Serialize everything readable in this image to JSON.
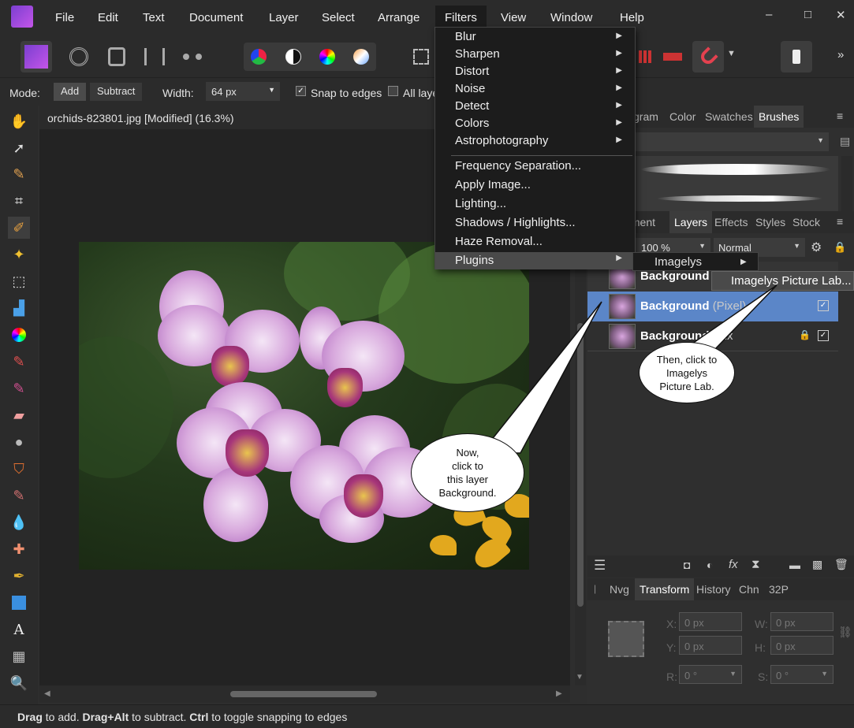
{
  "menubar": {
    "items": [
      "File",
      "Edit",
      "Text",
      "Document",
      "Layer",
      "Select",
      "Arrange",
      "Filters",
      "View",
      "Window",
      "Help"
    ],
    "active": "Filters",
    "window_controls": [
      "–",
      "□",
      "✕"
    ]
  },
  "context": {
    "mode_label": "Mode:",
    "add_label": "Add",
    "subtract_label": "Subtract",
    "width_label": "Width:",
    "width_value": "64 px",
    "snap_label": "Snap to edges",
    "all_layers_label": "All laye"
  },
  "document": {
    "tab_title": "orchids-823801.jpg [Modified] (16.3%)"
  },
  "filters_menu": {
    "group1": [
      "Blur",
      "Sharpen",
      "Distort",
      "Noise",
      "Detect",
      "Colors",
      "Astrophotography"
    ],
    "group2": [
      "Frequency Separation...",
      "Apply Image...",
      "Lighting...",
      "Shadows / Highlights...",
      "Haze Removal..."
    ],
    "plugins": "Plugins",
    "submenu_imagelys": "Imagelys",
    "submenu_picture_lab": "Imagelys Picture Lab..."
  },
  "right_panel": {
    "top_tabs": [
      "gram",
      "Color",
      "Swatches",
      "Brushes"
    ],
    "top_active": "Brushes",
    "layer_tabs": [
      "stment",
      "Layers",
      "Effects",
      "Styles",
      "Stock"
    ],
    "layer_active": "Layers",
    "opacity": "100 %",
    "blend_mode": "Normal",
    "layers": [
      {
        "name": "Background",
        "type": ""
      },
      {
        "name": "Background",
        "type": "(Pixel)"
      },
      {
        "name": "Background",
        "type": "(Pix"
      }
    ],
    "bottom_tabs": [
      "Nvg",
      "Transform",
      "History",
      "Chn",
      "32P"
    ],
    "bottom_active": "Transform",
    "transform": {
      "x_label": "X:",
      "x_value": "0 px",
      "y_label": "Y:",
      "y_value": "0 px",
      "w_label": "W:",
      "w_value": "0 px",
      "h_label": "H:",
      "h_value": "0 px",
      "r_label": "R:",
      "r_value": "0 °",
      "s_label": "S:",
      "s_value": "0 °"
    }
  },
  "callouts": {
    "now": [
      "Now,",
      "click to",
      "this layer",
      "Background."
    ],
    "then": [
      "Then, click to",
      "Imagelys",
      "Picture Lab."
    ]
  },
  "status": {
    "drag": "Drag",
    "t1": " to add. ",
    "drag_alt": "Drag+Alt",
    "t2": " to subtract. ",
    "ctrl": "Ctrl",
    "t3": " to toggle snapping to edges"
  }
}
